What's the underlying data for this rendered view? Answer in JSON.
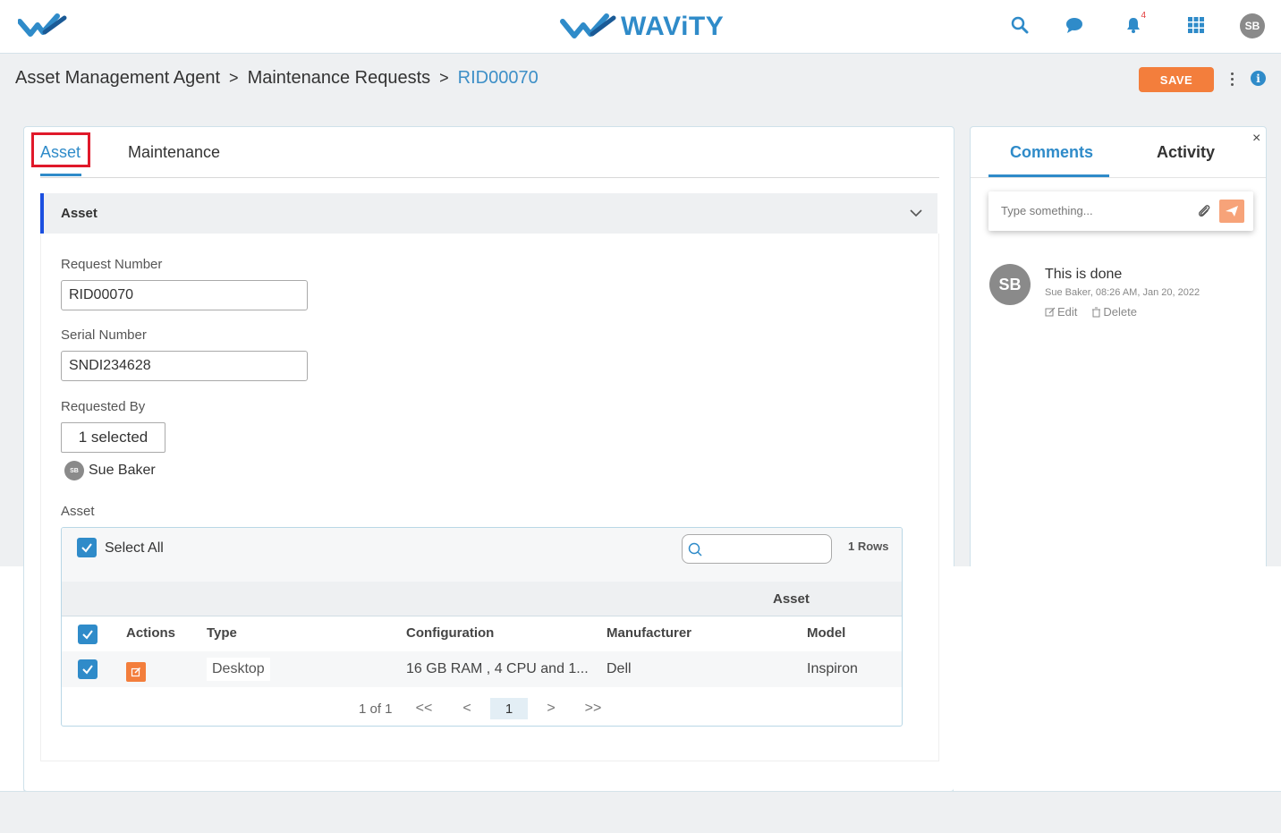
{
  "topbar": {
    "brand": "WAViTY",
    "notification_count": "4",
    "user_initials": "SB"
  },
  "breadcrumb": {
    "items": [
      "Asset Management Agent",
      "Maintenance Requests"
    ],
    "current": "RID00070",
    "separator": ">"
  },
  "toolbar": {
    "save_label": "SAVE"
  },
  "tabs": {
    "asset": "Asset",
    "maintenance": "Maintenance"
  },
  "section": {
    "title": "Asset"
  },
  "fields": {
    "request_number": {
      "label": "Request Number",
      "value": "RID00070"
    },
    "serial_number": {
      "label": "Serial Number",
      "value": "SNDI234628"
    },
    "requested_by": {
      "label": "Requested By",
      "summary": "1 selected",
      "user_initials": "SB",
      "user_name": "Sue Baker"
    },
    "asset": {
      "label": "Asset"
    }
  },
  "grid": {
    "select_all_label": "Select All",
    "rows_count": "1 Rows",
    "group_label": "Asset",
    "columns": [
      "Actions",
      "Type",
      "Configuration",
      "Manufacturer",
      "Model"
    ],
    "rows": [
      {
        "type": "Desktop",
        "configuration": "16 GB RAM , 4 CPU and 1...",
        "manufacturer": "Dell",
        "model": "Inspiron"
      }
    ],
    "pager": {
      "summary": "1 of 1",
      "current_page": "1",
      "first": "<<",
      "prev": "<",
      "next": ">",
      "last": ">>"
    }
  },
  "side_panel": {
    "tabs": {
      "comments": "Comments",
      "activity": "Activity"
    },
    "close": "×",
    "comment_placeholder": "Type something...",
    "comments": [
      {
        "initials": "SB",
        "text": "This is done",
        "meta": "Sue Baker, 08:26 AM, Jan 20, 2022",
        "edit": "Edit",
        "delete": "Delete"
      }
    ]
  },
  "colors": {
    "accent": "#2f8bc9",
    "save": "#f37e3c",
    "section_bar": "#1b4fe0",
    "highlight": "#e0192a"
  }
}
